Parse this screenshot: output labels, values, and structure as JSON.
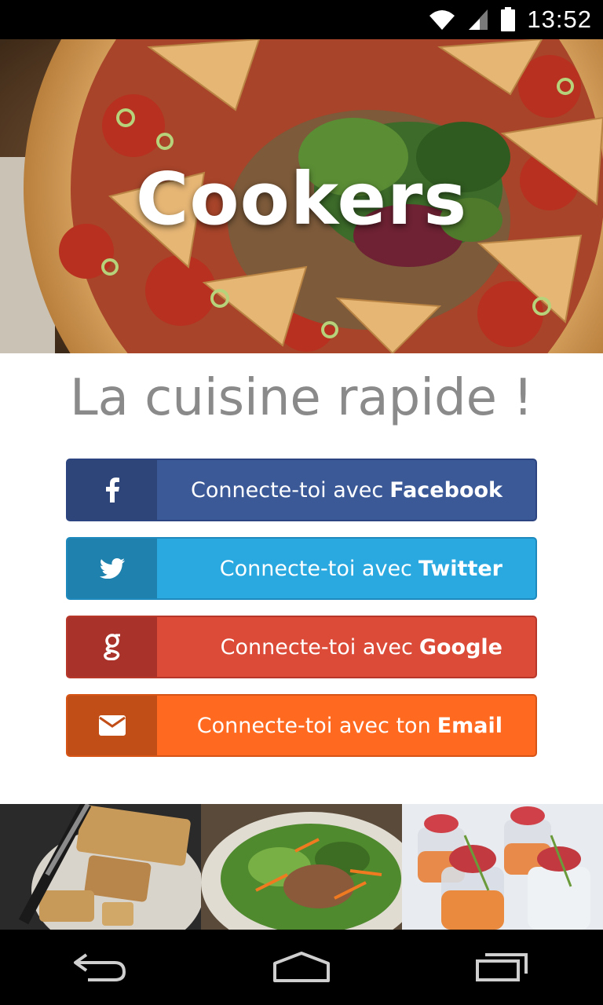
{
  "status_bar": {
    "time": "13:52",
    "icons": [
      "wifi-icon",
      "signal-icon",
      "battery-icon"
    ]
  },
  "hero": {
    "title": "Cookers"
  },
  "tagline": "La cuisine rapide !",
  "login_buttons": [
    {
      "id": "facebook",
      "prefix": "Connecte-toi avec",
      "brand": "Facebook",
      "icon": "facebook-icon",
      "color": "#3b5897",
      "icon_bg": "#2e4579"
    },
    {
      "id": "twitter",
      "prefix": "Connecte-toi avec",
      "brand": "Twitter",
      "icon": "twitter-icon",
      "color": "#29a9df",
      "icon_bg": "#1f81ad"
    },
    {
      "id": "google",
      "prefix": "Connecte-toi avec",
      "brand": "Google",
      "icon": "google-icon",
      "color": "#dc4a38",
      "icon_bg": "#a9332a"
    },
    {
      "id": "email",
      "prefix": "Connecte-toi avec ton",
      "brand": "Email",
      "icon": "email-icon",
      "color": "#ff6a20",
      "icon_bg": "#c24e17"
    }
  ],
  "food_strip": [
    "cake-photo",
    "salad-photo",
    "verrines-photo"
  ],
  "nav_bar": {
    "buttons": [
      "back-icon",
      "home-icon",
      "recents-icon"
    ]
  }
}
